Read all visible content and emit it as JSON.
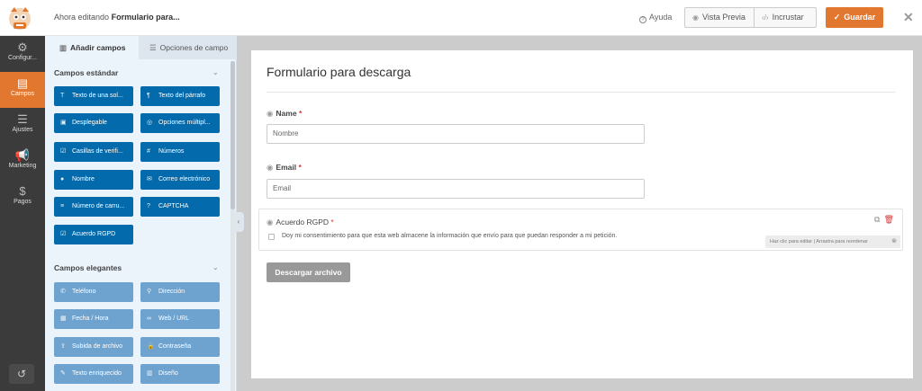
{
  "header": {
    "editing_prefix": "Ahora editando",
    "form_name": "Formulario para...",
    "help_label": "Ayuda",
    "preview_label": "Vista Previa",
    "embed_label": "Incrustar",
    "save_label": "Guardar",
    "accent": "#e27730"
  },
  "nav": {
    "items": [
      {
        "label": "Configur...",
        "icon": "gear-icon"
      },
      {
        "label": "Campos",
        "icon": "fields-icon",
        "active": true
      },
      {
        "label": "Ajustes",
        "icon": "sliders-icon"
      },
      {
        "label": "Marketing",
        "icon": "megaphone-icon"
      },
      {
        "label": "Pagos",
        "icon": "dollar-icon"
      }
    ]
  },
  "panel": {
    "tab_add": "Añadir campos",
    "tab_options": "Opciones de campo",
    "standard_title": "Campos estándar",
    "standard_fields": [
      {
        "label": "Texto de una sol...",
        "icon": "text-icon"
      },
      {
        "label": "Texto del párrafo",
        "icon": "paragraph-icon"
      },
      {
        "label": "Desplegable",
        "icon": "dropdown-icon"
      },
      {
        "label": "Opciones múltipl...",
        "icon": "radio-icon"
      },
      {
        "label": "Casillas de verifi...",
        "icon": "checkbox-icon"
      },
      {
        "label": "Números",
        "icon": "hash-icon"
      },
      {
        "label": "Nombre",
        "icon": "user-icon"
      },
      {
        "label": "Correo electrónico",
        "icon": "envelope-icon"
      },
      {
        "label": "Número de carru...",
        "icon": "sliders-icon"
      },
      {
        "label": "CAPTCHA",
        "icon": "question-icon"
      },
      {
        "label": "Acuerdo RGPD",
        "icon": "check-icon"
      }
    ],
    "fancy_title": "Campos elegantes",
    "fancy_fields": [
      {
        "label": "Teléfono",
        "icon": "phone-icon"
      },
      {
        "label": "Dirección",
        "icon": "location-icon"
      },
      {
        "label": "Fecha / Hora",
        "icon": "calendar-icon"
      },
      {
        "label": "Web / URL",
        "icon": "link-icon"
      },
      {
        "label": "Subida de archivo",
        "icon": "upload-icon"
      },
      {
        "label": "Contraseña",
        "icon": "lock-icon"
      },
      {
        "label": "Texto enriquecido",
        "icon": "edit-icon"
      },
      {
        "label": "Diseño",
        "icon": "layout-icon"
      }
    ]
  },
  "form": {
    "title": "Formulario para descarga",
    "name_label": "Name",
    "name_placeholder": "Nombre",
    "email_label": "Email",
    "email_placeholder": "Email",
    "gdpr_label": "Acuerdo RGPD",
    "gdpr_text": "Doy mi consentimiento para que esta web almacene la información que envío para que puedan responder a mi petición.",
    "hint": "Haz clic para editar | Arrastra para reordenar",
    "submit_label": "Descargar archivo",
    "required_marker": "*"
  }
}
